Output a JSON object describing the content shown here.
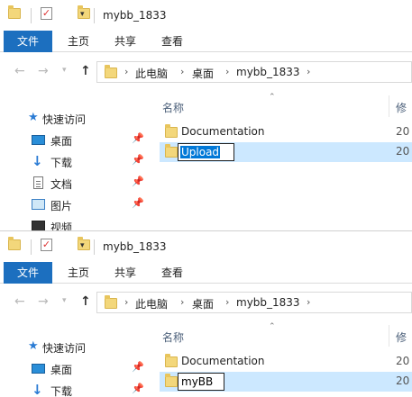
{
  "window": {
    "title": "mybb_1833"
  },
  "ribbon": {
    "tabs": [
      "文件",
      "主页",
      "共享",
      "查看"
    ]
  },
  "address": {
    "crumbs": [
      "此电脑",
      "桌面",
      "mybb_1833"
    ]
  },
  "nav": {
    "quick_access": "快速访问",
    "items": [
      "桌面",
      "下载",
      "文档",
      "图片",
      "视频"
    ]
  },
  "columns": {
    "name": "名称",
    "modified": "修"
  },
  "top": {
    "rows": [
      {
        "name": "Documentation",
        "date": "20"
      },
      {
        "name": "Upload",
        "date": "20"
      }
    ],
    "rename_value": "Upload"
  },
  "bottom": {
    "rows": [
      {
        "name": "Documentation",
        "date": "20"
      },
      {
        "name": "myBB",
        "date": "20"
      }
    ],
    "rename_value": "myBB"
  },
  "colors": {
    "accent": "#1c6fbf",
    "selection": "#cce8ff",
    "folder": "#f3d77b"
  }
}
